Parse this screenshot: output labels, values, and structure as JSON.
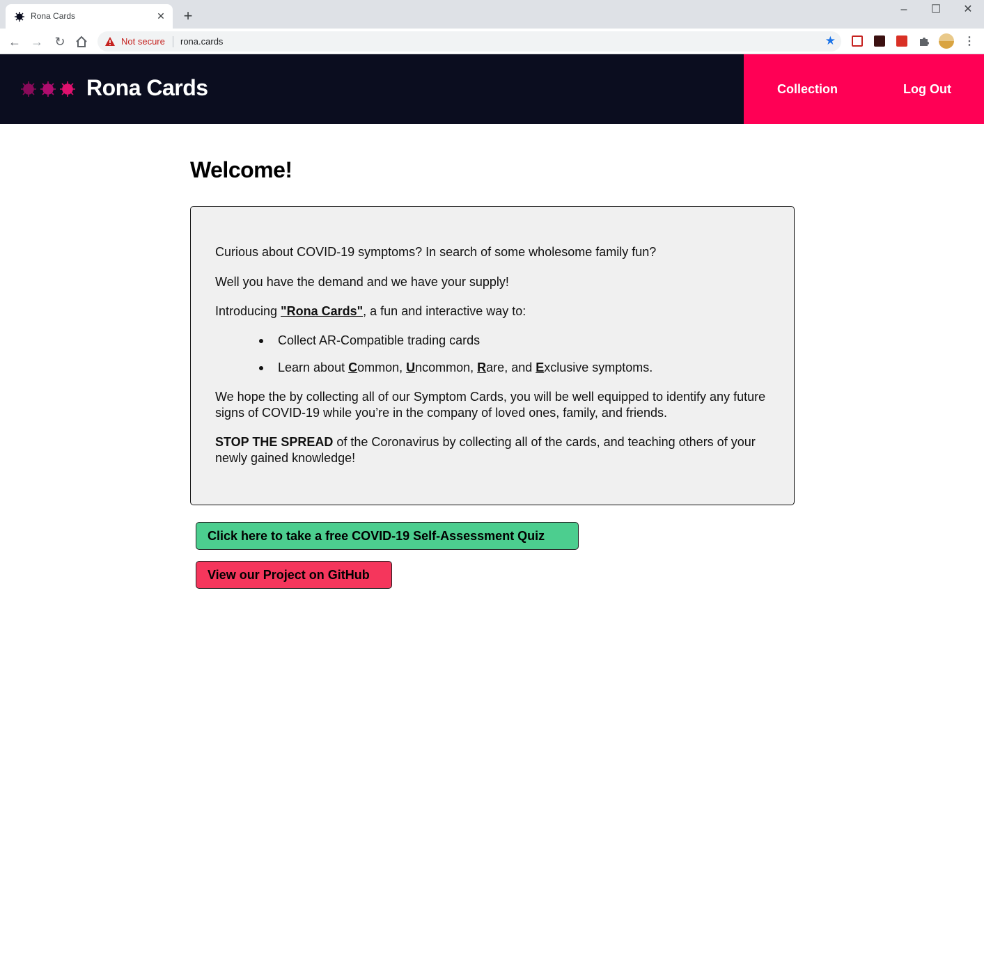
{
  "browser": {
    "tab_title": "Rona Cards",
    "new_tab_symbol": "+",
    "security_label": "Not secure",
    "url": "rona.cards"
  },
  "header": {
    "brand": "Rona Cards",
    "nav": [
      {
        "label": "Collection"
      },
      {
        "label": "Log Out"
      }
    ],
    "colors": {
      "background": "#0b0d1f",
      "accent": "#ff0055"
    }
  },
  "main": {
    "heading": "Welcome!",
    "intro_line1": "Curious about COVID-19 symptoms? In search of some wholesome family fun?",
    "intro_line2": "Well you have the demand and we have your supply!",
    "introducing_prefix": "Introducing ",
    "introducing_name": "\"Rona Cards\"",
    "introducing_suffix": ", a fun and interactive way to:",
    "bullet1": "Collect AR-Compatible trading cards",
    "bullet2": {
      "prefix": "Learn about ",
      "c": "C",
      "common_rest": "ommon, ",
      "u": "U",
      "uncommon_rest": "ncommon, ",
      "r": "R",
      "rare_rest": "are, and ",
      "e": "E",
      "exclusive_rest": "xclusive symptoms."
    },
    "hope_paragraph": "We hope the by collecting all of our Symptom Cards, you will be well equipped to identify any future signs of COVID-19 while you’re in the company of loved ones, family, and friends.",
    "stop_bold": "STOP THE SPREAD",
    "stop_rest": " of the Coronavirus by collecting all of the cards, and teaching others of your newly gained knowledge!"
  },
  "buttons": {
    "quiz": {
      "label": "Click here to take a free COVID-19 Self-Assessment Quiz",
      "color": "#4cce8f"
    },
    "github": {
      "label": "View our Project on GitHub",
      "color": "#f5365c"
    }
  }
}
